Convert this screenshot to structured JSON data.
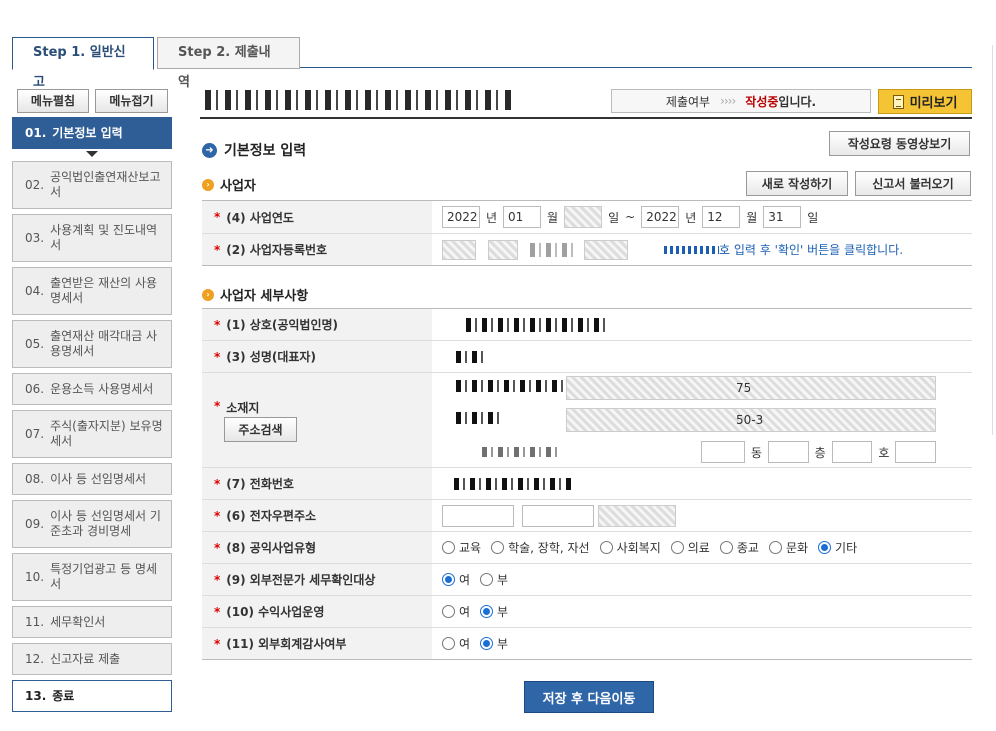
{
  "tabs": [
    {
      "label": "Step 1. 일반신고",
      "active": true
    },
    {
      "label": "Step 2. 제출내역",
      "active": false
    }
  ],
  "sidebar": {
    "expand_label": "메뉴펼침",
    "collapse_label": "메뉴접기",
    "items": [
      {
        "num": "01.",
        "label": "기본정보 입력"
      },
      {
        "num": "02.",
        "label": "공익법인출연재산보고서"
      },
      {
        "num": "03.",
        "label": "사용계획 및 진도내역서"
      },
      {
        "num": "04.",
        "label": "출연받은 재산의 사용명세서"
      },
      {
        "num": "05.",
        "label": "출연재산 매각대금 사용명세서"
      },
      {
        "num": "06.",
        "label": "운용소득 사용명세서"
      },
      {
        "num": "07.",
        "label": "주식(출자지분) 보유명세서"
      },
      {
        "num": "08.",
        "label": "이사 등 선임명세서"
      },
      {
        "num": "09.",
        "label": "이사 등 선임명세서 기준초과 경비명세"
      },
      {
        "num": "10.",
        "label": "특정기업광고 등 명세서"
      },
      {
        "num": "11.",
        "label": "세무확인서"
      },
      {
        "num": "12.",
        "label": "신고자료 제출"
      },
      {
        "num": "13.",
        "label": "종료"
      }
    ]
  },
  "header": {
    "status_prefix": "제출여부",
    "status_arrows": "››››",
    "status_value": "작성중",
    "status_suffix": "입니다.",
    "preview_label": "미리보기",
    "guide_video_label": "작성요령 동영상보기"
  },
  "section": {
    "title": "기본정보 입력",
    "business_title": "사업자",
    "new_write_label": "새로 작성하기",
    "load_report_label": "신고서 불러오기",
    "detail_title": "사업자 세부사항"
  },
  "business_year": {
    "label": "(4) 사업연도",
    "start_year": "2022",
    "start_month": "01",
    "end_year": "2022",
    "end_month": "12",
    "end_day": "31",
    "year_unit": "년",
    "month_unit": "월",
    "day_unit": "일",
    "tilde": "~"
  },
  "reg_number": {
    "label": "(2) 사업자등록번호",
    "hint": "호 입력 후 '확인' 버튼을 클릭합니다."
  },
  "details": {
    "company_label": "(1) 상호(공익법인명)",
    "ceo_label": "(3) 성명(대표자)",
    "address_label": "소재지",
    "address_search_label": "주소검색",
    "address_line1_suffix": "75",
    "address_line2_suffix": "50-3",
    "dong_label": "동",
    "floor_label": "층",
    "ho_label": "호",
    "phone_label": "(7) 전화번호",
    "email_label": "(6) 전자우편주소",
    "type_label": "(8) 공익사업유형",
    "type_options": [
      "교육",
      "학술, 장학, 자선",
      "사회복지",
      "의료",
      "종교",
      "문화",
      "기타"
    ],
    "type_selected": "기타",
    "external_label": "(9) 외부전문가 세무확인대상",
    "revenue_label": "(10) 수익사업운영",
    "audit_label": "(11) 외부회계감사여부",
    "yes": "여",
    "no": "부"
  },
  "footer": {
    "save_label": "저장 후 다음이동"
  }
}
